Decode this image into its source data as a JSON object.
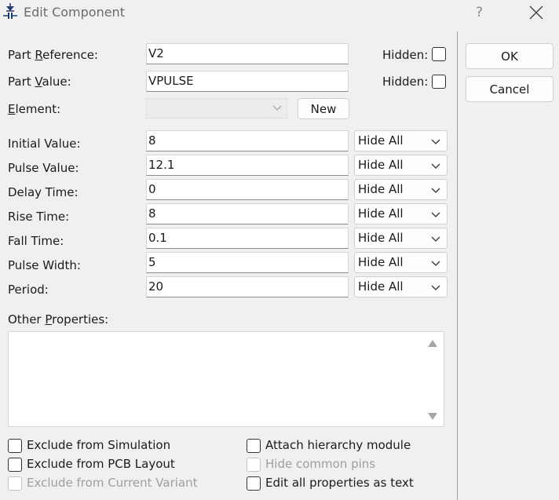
{
  "window": {
    "title": "Edit Component",
    "help_label": "?"
  },
  "part_reference": {
    "label_pre": "Part ",
    "label_key": "R",
    "label_post": "eference:",
    "value": "V2",
    "hidden_label": "Hidden:"
  },
  "part_value": {
    "label_pre": "Part ",
    "label_key": "V",
    "label_post": "alue:",
    "value": "VPULSE",
    "hidden_label": "Hidden:"
  },
  "element": {
    "label_key": "E",
    "label_post": "lement:",
    "value": "",
    "new_label": "New"
  },
  "parameters": [
    {
      "label": "Initial Value:",
      "value": "8",
      "visibility": "Hide All"
    },
    {
      "label": "Pulse Value:",
      "value": "12.1",
      "visibility": "Hide All"
    },
    {
      "label": "Delay Time:",
      "value": "0",
      "visibility": "Hide All"
    },
    {
      "label": "Rise Time:",
      "value": "8",
      "visibility": "Hide All"
    },
    {
      "label": "Fall Time:",
      "value": "0.1",
      "visibility": "Hide All"
    },
    {
      "label": "Pulse Width:",
      "value": "5",
      "visibility": "Hide All"
    },
    {
      "label": "Period:",
      "value": "20",
      "visibility": "Hide All"
    }
  ],
  "other_properties": {
    "label_pre": "Other ",
    "label_key": "P",
    "label_post": "roperties:",
    "value": ""
  },
  "buttons": {
    "ok": "OK",
    "cancel": "Cancel"
  },
  "checkboxes": {
    "exclude_simulation": "Exclude from Simulation",
    "exclude_pcb": "Exclude from PCB Layout",
    "exclude_variant": "Exclude from Current Variant",
    "attach_hierarchy": "Attach hierarchy module",
    "hide_common_pins": "Hide common pins",
    "edit_all_text": "Edit all properties as text"
  }
}
